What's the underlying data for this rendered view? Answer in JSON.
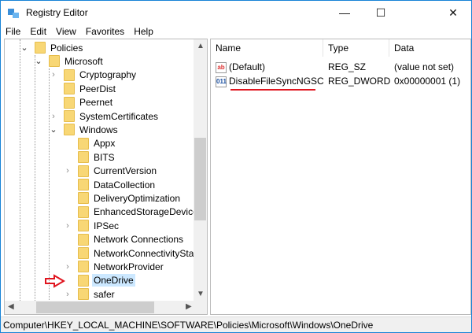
{
  "window": {
    "title": "Registry Editor",
    "minimize": "—",
    "maximize": "☐",
    "close": "✕"
  },
  "menu": [
    "File",
    "Edit",
    "View",
    "Favorites",
    "Help"
  ],
  "tree": [
    {
      "label": "Policies",
      "level": 1,
      "chevron": "open"
    },
    {
      "label": "Microsoft",
      "level": 2,
      "chevron": "open"
    },
    {
      "label": "Cryptography",
      "level": 3,
      "chevron": "closed"
    },
    {
      "label": "PeerDist",
      "level": 3,
      "chevron": "none"
    },
    {
      "label": "Peernet",
      "level": 3,
      "chevron": "none"
    },
    {
      "label": "SystemCertificates",
      "level": 3,
      "chevron": "closed"
    },
    {
      "label": "Windows",
      "level": 3,
      "chevron": "open"
    },
    {
      "label": "Appx",
      "level": 4,
      "chevron": "none"
    },
    {
      "label": "BITS",
      "level": 4,
      "chevron": "none"
    },
    {
      "label": "CurrentVersion",
      "level": 4,
      "chevron": "closed"
    },
    {
      "label": "DataCollection",
      "level": 4,
      "chevron": "none"
    },
    {
      "label": "DeliveryOptimization",
      "level": 4,
      "chevron": "none"
    },
    {
      "label": "EnhancedStorageDevices",
      "level": 4,
      "chevron": "none"
    },
    {
      "label": "IPSec",
      "level": 4,
      "chevron": "closed"
    },
    {
      "label": "Network Connections",
      "level": 4,
      "chevron": "none"
    },
    {
      "label": "NetworkConnectivityStat",
      "level": 4,
      "chevron": "none"
    },
    {
      "label": "NetworkProvider",
      "level": 4,
      "chevron": "closed"
    },
    {
      "label": "OneDrive",
      "level": 4,
      "chevron": "none",
      "selected": true
    },
    {
      "label": "safer",
      "level": 4,
      "chevron": "closed"
    }
  ],
  "columns": {
    "name": "Name",
    "type": "Type",
    "data": "Data"
  },
  "values": [
    {
      "name": "(Default)",
      "type": "REG_SZ",
      "data": "(value not set)",
      "icon": "ab"
    },
    {
      "name": "DisableFileSyncNGSC",
      "type": "REG_DWORD",
      "data": "0x00000001 (1)",
      "icon": "011"
    }
  ],
  "status": "Computer\\HKEY_LOCAL_MACHINE\\SOFTWARE\\Policies\\Microsoft\\Windows\\OneDrive",
  "colors": {
    "annotation": "#e0141e",
    "selection": "#cce8ff"
  }
}
